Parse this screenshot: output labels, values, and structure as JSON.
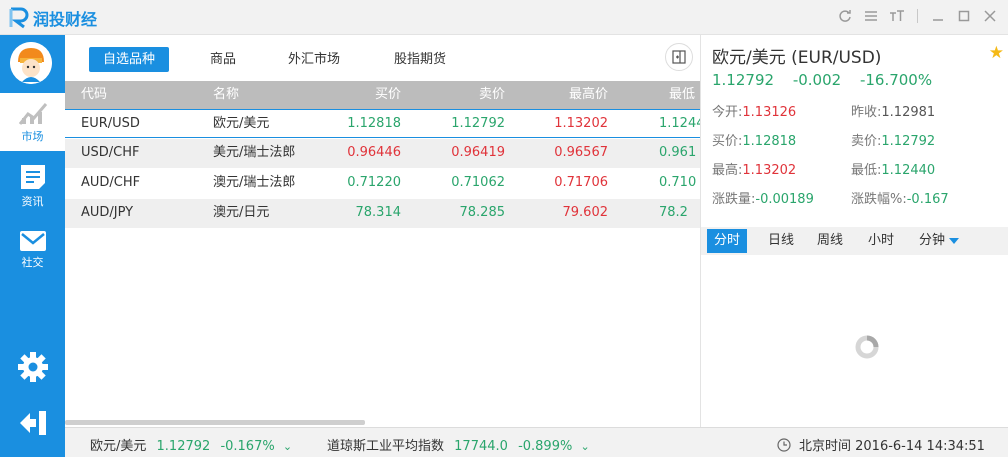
{
  "app": {
    "brand_part1": "润投",
    "brand_part2": "财经"
  },
  "window_controls": [
    "refresh-icon",
    "list-icon",
    "font-size-icon",
    "minimize-icon",
    "maximize-icon",
    "close-icon"
  ],
  "sidebar": {
    "items": [
      {
        "label": "市场",
        "icon": "chart-icon",
        "active": true
      },
      {
        "label": "资讯",
        "icon": "news-icon",
        "active": false
      },
      {
        "label": "社交",
        "icon": "mail-icon",
        "active": false
      }
    ],
    "bottom_icons": [
      "gear-icon",
      "exit-icon"
    ]
  },
  "tabs": [
    {
      "label": "自选品种",
      "active": true
    },
    {
      "label": "商品",
      "active": false
    },
    {
      "label": "外汇市场",
      "active": false
    },
    {
      "label": "股指期货",
      "active": false
    }
  ],
  "table": {
    "headers": [
      "代码",
      "名称",
      "买价",
      "卖价",
      "最高价",
      "最低"
    ],
    "rows": [
      {
        "code": "EUR/USD",
        "name": "欧元/美元",
        "bid": "1.12818",
        "ask": "1.12792",
        "high": "1.13202",
        "low": "1.1244",
        "bid_dir": "down",
        "ask_dir": "down",
        "high_dir": "up",
        "low_dir": "down",
        "selected": true
      },
      {
        "code": "USD/CHF",
        "name": "美元/瑞士法郎",
        "bid": "0.96446",
        "ask": "0.96419",
        "high": "0.96567",
        "low": "0.961",
        "bid_dir": "up",
        "ask_dir": "up",
        "high_dir": "up",
        "low_dir": "down",
        "selected": false
      },
      {
        "code": "AUD/CHF",
        "name": "澳元/瑞士法郎",
        "bid": "0.71220",
        "ask": "0.71062",
        "high": "0.71706",
        "low": "0.710",
        "bid_dir": "down",
        "ask_dir": "down",
        "high_dir": "up",
        "low_dir": "down",
        "selected": false
      },
      {
        "code": "AUD/JPY",
        "name": "澳元/日元",
        "bid": "78.314",
        "ask": "78.285",
        "high": "79.602",
        "low": "78.2",
        "bid_dir": "down",
        "ask_dir": "down",
        "high_dir": "up",
        "low_dir": "down",
        "selected": false
      }
    ]
  },
  "panel": {
    "title": "欧元/美元  (EUR/USD)",
    "price": "1.12792",
    "change": "-0.002",
    "change_pct": "-16.700%",
    "stats": [
      {
        "key": "今开:",
        "value": "1.13126",
        "dir": "up"
      },
      {
        "key": "昨收:",
        "value": "1.12981",
        "dir": "neutral"
      },
      {
        "key": "买价:",
        "value": "1.12818",
        "dir": "down"
      },
      {
        "key": "卖价:",
        "value": "1.12792",
        "dir": "down"
      },
      {
        "key": "最高:",
        "value": "1.13202",
        "dir": "up"
      },
      {
        "key": "最低:",
        "value": "1.12440",
        "dir": "down"
      },
      {
        "key": "涨跌量:",
        "value": "-0.00189",
        "dir": "down"
      },
      {
        "key": "涨跌幅%:",
        "value": "-0.167",
        "dir": "down"
      }
    ],
    "time_tabs": [
      {
        "label": "分时",
        "active": true
      },
      {
        "label": "日线",
        "active": false
      },
      {
        "label": "周线",
        "active": false
      },
      {
        "label": "小时",
        "active": false
      },
      {
        "label": "分钟",
        "active": false
      }
    ]
  },
  "status": {
    "ticker1_name": "欧元/美元",
    "ticker1_price": "1.12792",
    "ticker1_pct": "-0.167%",
    "ticker2_name": "道琼斯工业平均指数",
    "ticker2_price": "17744.0",
    "ticker2_pct": "-0.899%",
    "time_label": "北京时间 2016-6-14 14:34:51"
  },
  "colors": {
    "accent": "#1a8fe0",
    "up": "#e0333a",
    "down": "#2aa56c"
  }
}
